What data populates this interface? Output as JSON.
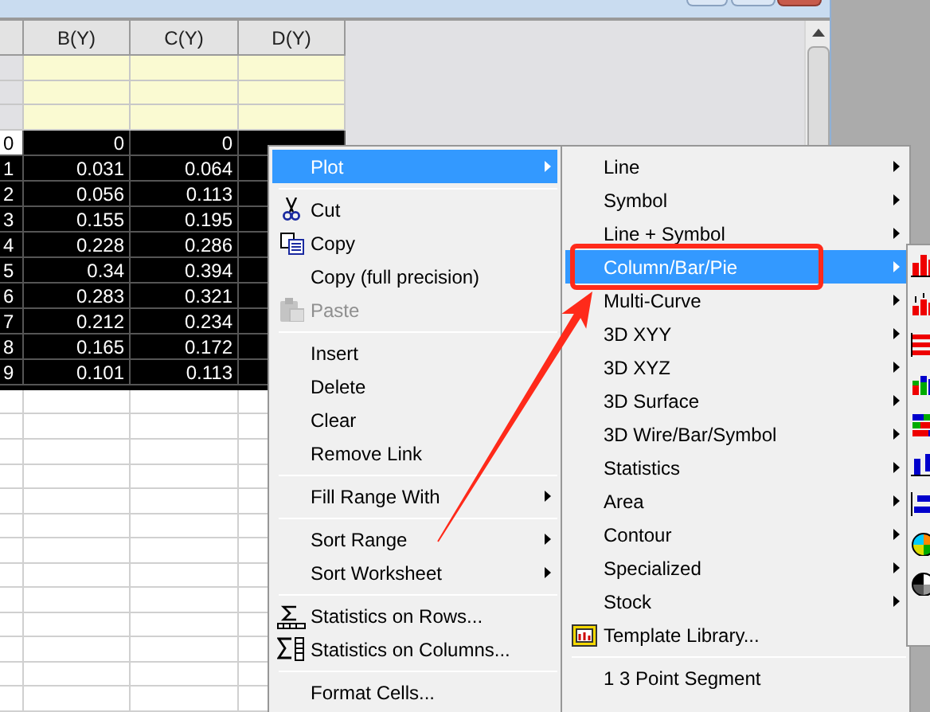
{
  "worksheet": {
    "columns": [
      "B(Y)",
      "C(Y)",
      "D(Y)"
    ],
    "rows": [
      {
        "index": "0",
        "values": [
          "0",
          "0"
        ],
        "active": true,
        "selected": true
      },
      {
        "index": "1",
        "values": [
          "0.031",
          "0.064"
        ],
        "active": false,
        "selected": true
      },
      {
        "index": "2",
        "values": [
          "0.056",
          "0.113"
        ],
        "active": false,
        "selected": true
      },
      {
        "index": "3",
        "values": [
          "0.155",
          "0.195"
        ],
        "active": false,
        "selected": true
      },
      {
        "index": "4",
        "values": [
          "0.228",
          "0.286"
        ],
        "active": false,
        "selected": true
      },
      {
        "index": "5",
        "values": [
          "0.34",
          "0.394"
        ],
        "active": false,
        "selected": true
      },
      {
        "index": "6",
        "values": [
          "0.283",
          "0.321"
        ],
        "active": false,
        "selected": true
      },
      {
        "index": "7",
        "values": [
          "0.212",
          "0.234"
        ],
        "active": false,
        "selected": true
      },
      {
        "index": "8",
        "values": [
          "0.165",
          "0.172"
        ],
        "active": false,
        "selected": true
      },
      {
        "index": "9",
        "values": [
          "0.101",
          "0.113"
        ],
        "active": false,
        "selected": true
      }
    ]
  },
  "context_menu": {
    "items": [
      {
        "kind": "plain",
        "label": "Plot",
        "selected": true,
        "disabled": false,
        "submenu": true
      },
      {
        "kind": "separator"
      },
      {
        "kind": "scissors",
        "label": "Cut",
        "selected": false,
        "disabled": false,
        "submenu": false
      },
      {
        "kind": "copy",
        "label": "Copy",
        "selected": false,
        "disabled": false,
        "submenu": false
      },
      {
        "kind": "plain",
        "label": "Copy (full precision)",
        "selected": false,
        "disabled": false,
        "submenu": false
      },
      {
        "kind": "paste",
        "label": "Paste",
        "selected": false,
        "disabled": true,
        "submenu": false
      },
      {
        "kind": "separator"
      },
      {
        "kind": "plain",
        "label": "Insert",
        "selected": false,
        "disabled": false,
        "submenu": false
      },
      {
        "kind": "plain",
        "label": "Delete",
        "selected": false,
        "disabled": false,
        "submenu": false
      },
      {
        "kind": "plain",
        "label": "Clear",
        "selected": false,
        "disabled": false,
        "submenu": false
      },
      {
        "kind": "plain",
        "label": "Remove Link",
        "selected": false,
        "disabled": false,
        "submenu": false
      },
      {
        "kind": "separator"
      },
      {
        "kind": "plain",
        "label": "Fill Range With",
        "selected": false,
        "disabled": false,
        "submenu": true
      },
      {
        "kind": "separator"
      },
      {
        "kind": "plain",
        "label": "Sort Range",
        "selected": false,
        "disabled": false,
        "submenu": true
      },
      {
        "kind": "plain",
        "label": "Sort Worksheet",
        "selected": false,
        "disabled": false,
        "submenu": true
      },
      {
        "kind": "separator"
      },
      {
        "kind": "sigma-rows",
        "label": "Statistics on Rows...",
        "selected": false,
        "disabled": false,
        "submenu": false
      },
      {
        "kind": "sigma-columns",
        "label": "Statistics on Columns...",
        "selected": false,
        "disabled": false,
        "submenu": false
      },
      {
        "kind": "separator"
      },
      {
        "kind": "plain",
        "label": "Format Cells...",
        "selected": false,
        "disabled": false,
        "submenu": false
      }
    ]
  },
  "plot_menu": {
    "items": [
      {
        "kind": "plain",
        "label": "Line",
        "selected": false,
        "submenu": true
      },
      {
        "kind": "plain",
        "label": "Symbol",
        "selected": false,
        "submenu": true
      },
      {
        "kind": "plain",
        "label": "Line + Symbol",
        "selected": false,
        "submenu": true
      },
      {
        "kind": "plain",
        "label": "Column/Bar/Pie",
        "selected": true,
        "submenu": true
      },
      {
        "kind": "plain",
        "label": "Multi-Curve",
        "selected": false,
        "submenu": true
      },
      {
        "kind": "plain",
        "label": "3D XYY",
        "selected": false,
        "submenu": true
      },
      {
        "kind": "plain",
        "label": "3D XYZ",
        "selected": false,
        "submenu": true
      },
      {
        "kind": "plain",
        "label": "3D Surface",
        "selected": false,
        "submenu": true
      },
      {
        "kind": "plain",
        "label": "3D Wire/Bar/Symbol",
        "selected": false,
        "submenu": true
      },
      {
        "kind": "plain",
        "label": "Statistics",
        "selected": false,
        "submenu": true
      },
      {
        "kind": "plain",
        "label": "Area",
        "selected": false,
        "submenu": true
      },
      {
        "kind": "plain",
        "label": "Contour",
        "selected": false,
        "submenu": true
      },
      {
        "kind": "plain",
        "label": "Specialized",
        "selected": false,
        "submenu": true
      },
      {
        "kind": "plain",
        "label": "Stock",
        "selected": false,
        "submenu": true
      },
      {
        "kind": "template",
        "label": "Template Library...",
        "selected": false,
        "submenu": false
      },
      {
        "kind": "separator"
      },
      {
        "kind": "plain",
        "label": "1 3 Point Segment",
        "selected": false,
        "submenu": false
      }
    ]
  },
  "chart_type_menu": {
    "items": [
      {
        "kind": "column"
      },
      {
        "kind": "column-labeled"
      },
      {
        "kind": "bar"
      },
      {
        "kind": "column-stacked"
      },
      {
        "kind": "bar-stacked"
      },
      {
        "kind": "column-floating"
      },
      {
        "kind": "bar-floating"
      },
      {
        "kind": "pie-color"
      },
      {
        "kind": "pie-gray"
      }
    ]
  }
}
